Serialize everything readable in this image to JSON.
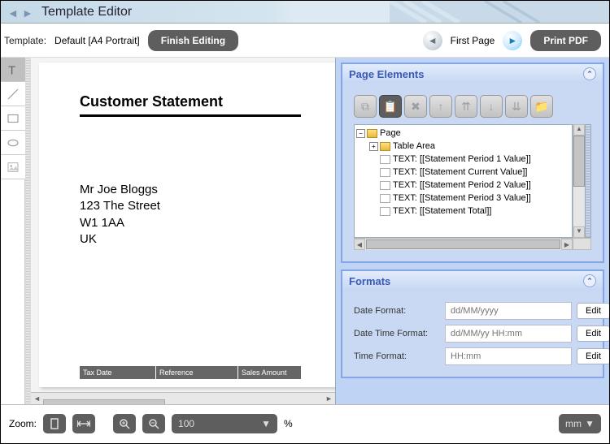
{
  "header": {
    "title": "Template Editor"
  },
  "toolbar": {
    "template_label": "Template:",
    "template_name": "Default [A4 Portrait]",
    "finish_label": "Finish Editing",
    "page_label": "First Page",
    "print_label": "Print PDF"
  },
  "document": {
    "heading": "Customer Statement",
    "address": [
      "Mr Joe Bloggs",
      "123 The Street",
      "W1 1AA",
      "UK"
    ],
    "table_headers": [
      "Tax Date",
      "Reference",
      "Sales Amount"
    ]
  },
  "page_elements_panel": {
    "title": "Page Elements",
    "tree": {
      "root": "Page",
      "children": [
        {
          "label": "Table Area",
          "type": "folder"
        },
        {
          "label": "TEXT: [[Statement Period 1 Value]]",
          "type": "text"
        },
        {
          "label": "TEXT: [[Statement Current Value]]",
          "type": "text"
        },
        {
          "label": "TEXT: [[Statement Period 2 Value]]",
          "type": "text"
        },
        {
          "label": "TEXT: [[Statement Period 3 Value]]",
          "type": "text"
        },
        {
          "label": "TEXT: [[Statement Total]]",
          "type": "text"
        }
      ]
    }
  },
  "formats_panel": {
    "title": "Formats",
    "rows": [
      {
        "label": "Date Format:",
        "placeholder": "dd/MM/yyyy",
        "edit": "Edit"
      },
      {
        "label": "Date Time Format:",
        "placeholder": "dd/MM/yy HH:mm",
        "edit": "Edit"
      },
      {
        "label": "Time Format:",
        "placeholder": "HH:mm",
        "edit": "Edit"
      }
    ]
  },
  "footer": {
    "zoom_label": "Zoom:",
    "zoom_value": "100",
    "percent": "%",
    "unit": "mm"
  }
}
